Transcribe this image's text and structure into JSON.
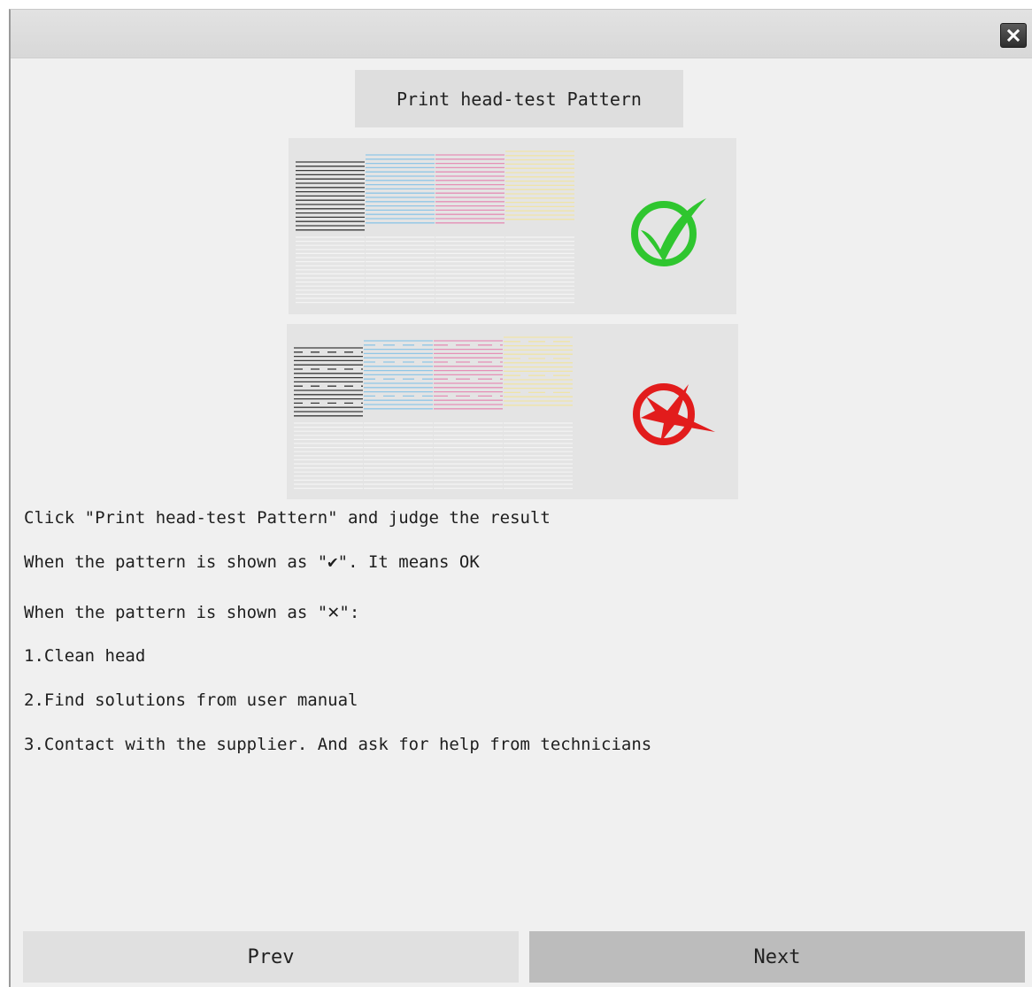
{
  "dialog": {
    "close_icon": "close-x-icon"
  },
  "print_button": {
    "label": "Print head-test Pattern"
  },
  "examples": {
    "good": {
      "mark_icon": "check-circle-icon",
      "mark_color": "#2fc62f"
    },
    "bad": {
      "mark_icon": "cross-circle-icon",
      "mark_color": "#e21c1c"
    },
    "ink_colors": [
      "#3a3a3a",
      "#8fc6e6",
      "#e58fb6",
      "#f0e4a6"
    ]
  },
  "instructions": {
    "line1": "Click \"Print head-test Pattern\" and judge the result",
    "line2_pre": "When the pattern is shown as \"",
    "line2_mark": "✔",
    "line2_post": "\". It means OK",
    "line3_pre": "When the pattern is shown as \"",
    "line3_mark": "✕",
    "line3_post": "\":",
    "step1": "1.Clean head",
    "step2": "2.Find solutions from user manual",
    "step3": "3.Contact with the supplier. And ask for help from technicians"
  },
  "nav": {
    "prev_label": "Prev",
    "next_label": "Next"
  }
}
